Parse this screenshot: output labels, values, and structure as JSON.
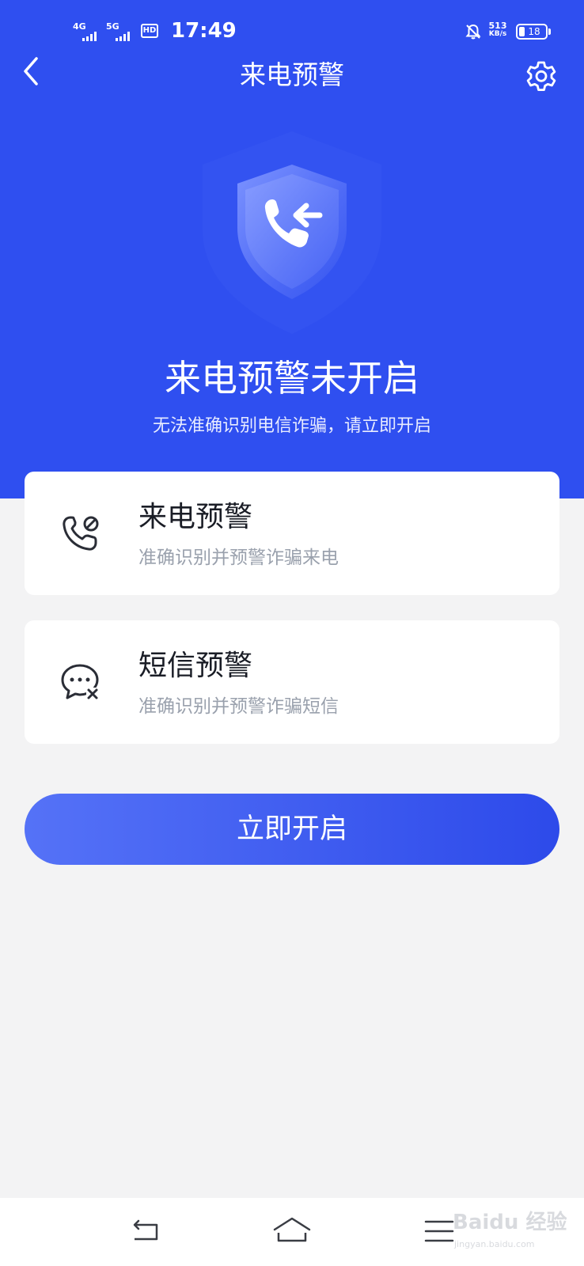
{
  "status_bar": {
    "network_1": "4G",
    "network_2": "5G",
    "hd": "HD",
    "time": "17:49",
    "speed_value": "513",
    "speed_unit": "KB/s",
    "battery": "18"
  },
  "header": {
    "title": "来电预警"
  },
  "hero": {
    "title": "来电预警未开启",
    "subtitle": "无法准确识别电信诈骗，请立即开启"
  },
  "cards": [
    {
      "title": "来电预警",
      "description": "准确识别并预警诈骗来电",
      "icon": "phone-block-icon"
    },
    {
      "title": "短信预警",
      "description": "准确识别并预警诈骗短信",
      "icon": "message-block-icon"
    }
  ],
  "cta": {
    "label": "立即开启"
  },
  "watermark": {
    "text": "Baidu 经验",
    "sub": "jingyan.baidu.com"
  },
  "colors": {
    "primary": "#2f4ff0",
    "button_start": "#5572f7",
    "button_end": "#2d4aea",
    "background": "#f3f3f4"
  }
}
